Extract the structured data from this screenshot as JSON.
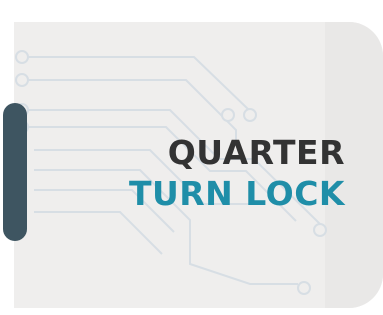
{
  "title": {
    "line1": "QUARTER",
    "line2": "TURN LOCK"
  },
  "colors": {
    "panel": "#efeeed",
    "handle": "#3e5561",
    "line1_text": "#333333",
    "line2_text": "#1f8ea8",
    "circuit": "#d7dee4"
  },
  "icons": {
    "background": "circuit-trace-pattern",
    "handle": "lock-handle"
  }
}
